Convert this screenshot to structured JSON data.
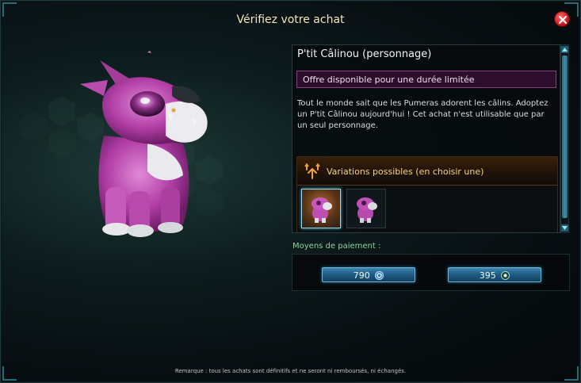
{
  "dialog": {
    "title": "Vérifiez votre achat"
  },
  "item": {
    "name": "P'tit Câlinou (personnage)",
    "offer_banner": "Offre disponible pour une durée limitée",
    "description": "Tout le monde sait que les Pumeras adorent les câlins. Adoptez un P'tit Câlinou aujourd'hui ! Cet achat n'est utilisable que par un seul personnage."
  },
  "variations": {
    "label": "Variations possibles (en choisir une)",
    "options": [
      {
        "selected": true
      },
      {
        "selected": false
      }
    ]
  },
  "payment": {
    "label": "Moyens de paiement :",
    "options": [
      {
        "amount": "790",
        "currency_icon": "ogrines-icon"
      },
      {
        "amount": "395",
        "currency_icon": "kroz-icon"
      }
    ]
  },
  "footer_note": "Remarque : tous les achats sont définitifs et ne seront ni remboursés, ni échangés.",
  "colors": {
    "title": "#f3e6b8",
    "offer_border": "#8d3c86",
    "variations_label": "#f6d38a",
    "payment_label": "#8fd3a1",
    "button_blue": "#1f5e86",
    "close_red": "#c10f14"
  }
}
